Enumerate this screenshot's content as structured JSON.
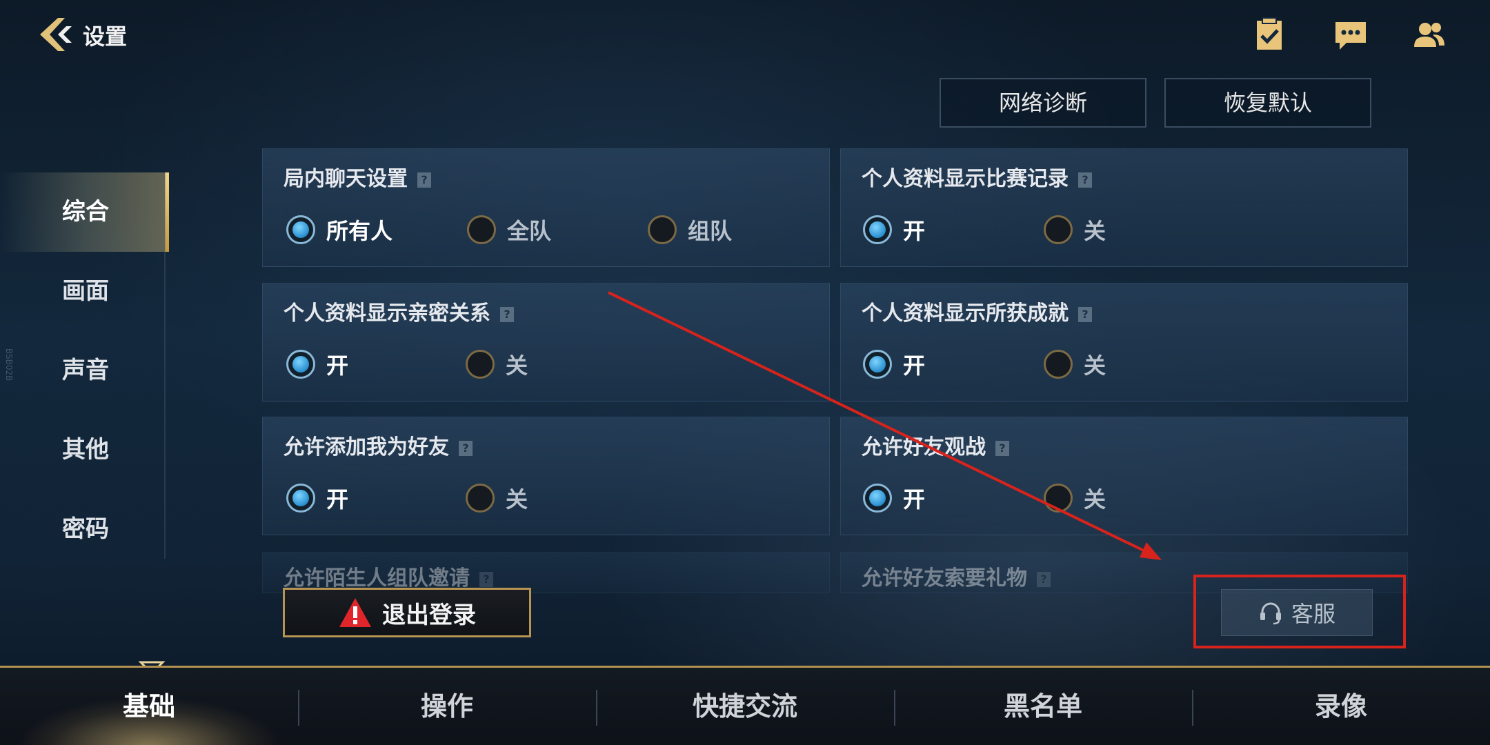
{
  "header": {
    "title": "设置",
    "icons": [
      "task-checklist-icon",
      "chat-bubble-icon",
      "friends-icon"
    ],
    "network_btn": "网络诊断",
    "reset_btn": "恢复默认"
  },
  "side_nav": {
    "items": [
      {
        "label": "综合",
        "active": true
      },
      {
        "label": "画面",
        "active": false
      },
      {
        "label": "声音",
        "active": false
      },
      {
        "label": "其他",
        "active": false
      },
      {
        "label": "密码",
        "active": false
      }
    ],
    "vertical_id": "BSB02B"
  },
  "settings": [
    {
      "title": "局内聊天设置",
      "options": [
        "所有人",
        "全队",
        "组队"
      ],
      "selected": 0
    },
    {
      "title": "个人资料显示比赛记录",
      "options": [
        "开",
        "关"
      ],
      "selected": 0
    },
    {
      "title": "个人资料显示亲密关系",
      "options": [
        "开",
        "关"
      ],
      "selected": 0
    },
    {
      "title": "个人资料显示所获成就",
      "options": [
        "开",
        "关"
      ],
      "selected": 0
    },
    {
      "title": "允许添加我为好友",
      "options": [
        "开",
        "关"
      ],
      "selected": 0
    },
    {
      "title": "允许好友观战",
      "options": [
        "开",
        "关"
      ],
      "selected": 0
    },
    {
      "title": "允许陌生人组队邀请",
      "options": [],
      "selected": null
    },
    {
      "title": "允许好友索要礼物",
      "options": [],
      "selected": null
    }
  ],
  "actions": {
    "logout": "退出登录",
    "customer_service": "客服"
  },
  "tabs": [
    {
      "label": "基础",
      "active": true
    },
    {
      "label": "操作",
      "active": false
    },
    {
      "label": "快捷交流",
      "active": false
    },
    {
      "label": "黑名单",
      "active": false
    },
    {
      "label": "录像",
      "active": false
    }
  ],
  "colors": {
    "accent_gold": "#c79a3e",
    "radio_on": "#2a8fcf",
    "annotation_red": "#d8231c"
  }
}
